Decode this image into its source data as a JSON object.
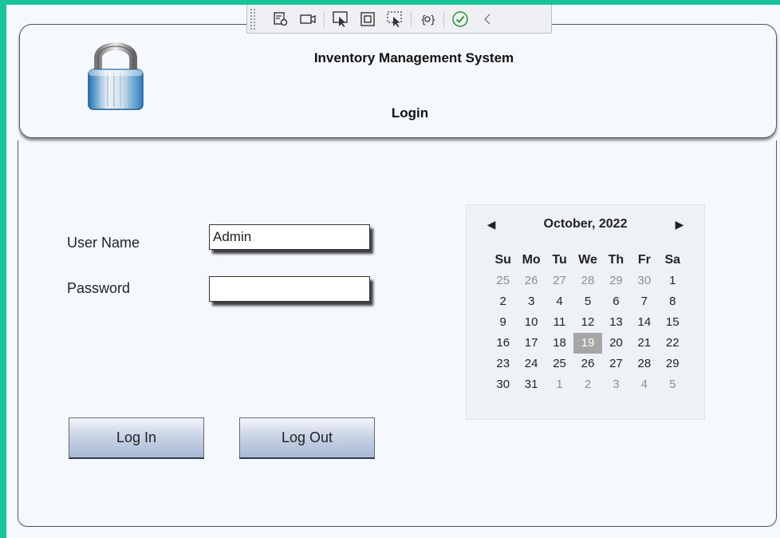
{
  "app": {
    "title": "Inventory Management System",
    "subtitle": "Login"
  },
  "debug_toolbar": {
    "items": [
      "properties-icon",
      "camera-icon",
      "select-element-icon",
      "frame-icon",
      "track-focus-icon",
      "binding-icon",
      "checkmark-icon",
      "collapse-chevron-icon"
    ]
  },
  "form": {
    "username_label": "User Name",
    "username_value": "Admin",
    "password_label": "Password",
    "password_value": ""
  },
  "buttons": {
    "login_label": "Log In",
    "logout_label": "Log Out"
  },
  "calendar": {
    "month_label": "October, 2022",
    "prev_arrow": "◀",
    "next_arrow": "▶",
    "weekdays": [
      "Su",
      "Mo",
      "Tu",
      "We",
      "Th",
      "Fr",
      "Sa"
    ],
    "weeks": [
      [
        "25",
        "26",
        "27",
        "28",
        "29",
        "30",
        "1"
      ],
      [
        "2",
        "3",
        "4",
        "5",
        "6",
        "7",
        "8"
      ],
      [
        "9",
        "10",
        "11",
        "12",
        "13",
        "14",
        "15"
      ],
      [
        "16",
        "17",
        "18",
        "19",
        "20",
        "21",
        "22"
      ],
      [
        "23",
        "24",
        "25",
        "26",
        "27",
        "28",
        "29"
      ],
      [
        "30",
        "31",
        "1",
        "2",
        "3",
        "4",
        "5"
      ]
    ],
    "selected_day": "19"
  },
  "colors": {
    "background": "#18c49a",
    "window": "#f5f9fd",
    "selected_day": "#a6a6a6",
    "button_gradient_bottom": "#a9b9d4"
  }
}
